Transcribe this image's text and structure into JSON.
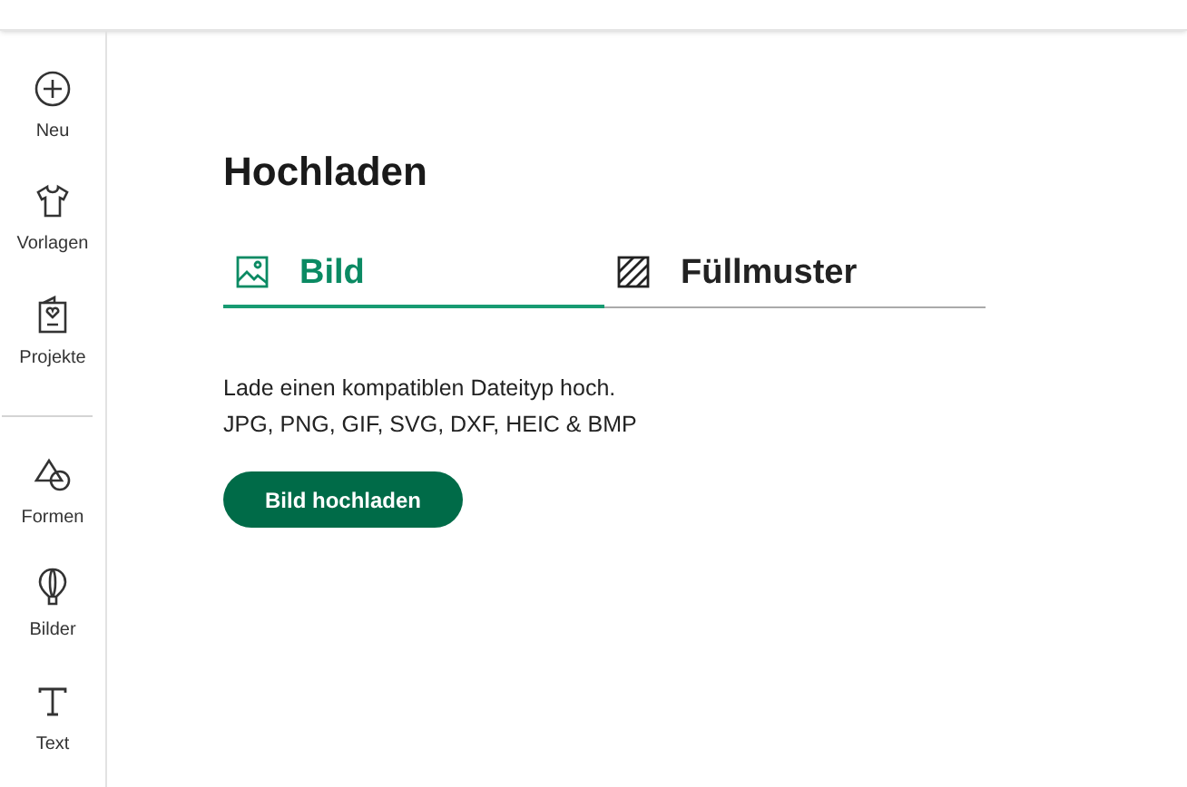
{
  "sidebar": {
    "groups": [
      {
        "items": [
          {
            "kind": "plus",
            "label": "Neu"
          },
          {
            "kind": "shirt",
            "label": "Vorlagen"
          },
          {
            "kind": "card",
            "label": "Projekte"
          }
        ]
      },
      {
        "items": [
          {
            "kind": "shapes",
            "label": "Formen"
          },
          {
            "kind": "balloon",
            "label": "Bilder"
          },
          {
            "kind": "text",
            "label": "Text"
          }
        ]
      }
    ]
  },
  "panel": {
    "title": "Hochladen",
    "tabs": [
      {
        "kind": "image",
        "label": "Bild",
        "selected": true
      },
      {
        "kind": "pattern",
        "label": "Füllmuster",
        "selected": false
      }
    ],
    "description": [
      "Lade einen kompatiblen Dateityp hoch.",
      "JPG, PNG, GIF, SVG, DXF, HEIC & BMP"
    ],
    "button": "Bild hochladen"
  }
}
